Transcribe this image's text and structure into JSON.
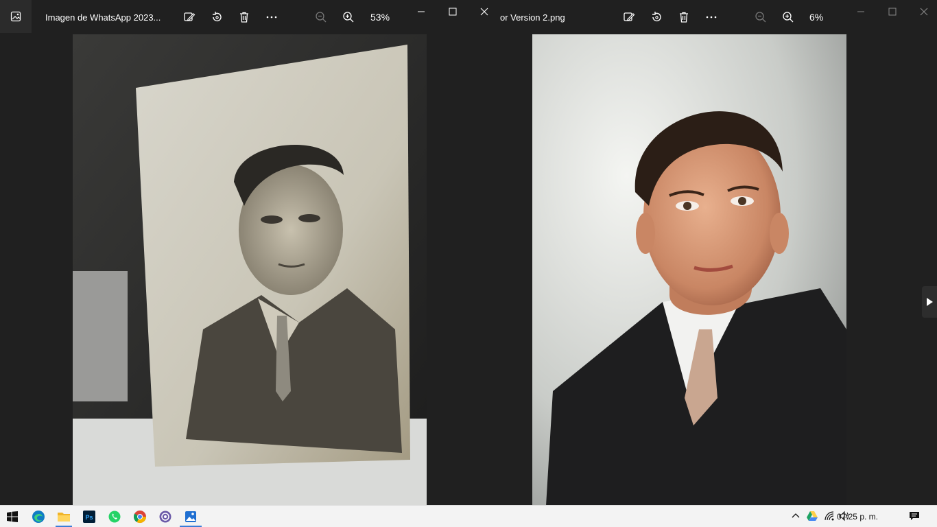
{
  "window1": {
    "title": "Imagen de WhatsApp 2023...",
    "zoom": "53%",
    "icons": [
      "image-app-icon",
      "edit-icon",
      "rotate-icon",
      "delete-icon",
      "more-icon",
      "zoom-out-icon",
      "zoom-in-icon"
    ]
  },
  "window2": {
    "title": "or  Version 2.png",
    "zoom": "6%",
    "icons": [
      "edit-icon",
      "rotate-icon",
      "delete-icon",
      "more-icon",
      "zoom-out-icon",
      "zoom-in-icon",
      "next-image-icon"
    ]
  },
  "photos": {
    "left": {
      "description_visible": false
    },
    "right": {
      "description_visible": false
    }
  },
  "taskbar": {
    "apps": [
      "start-icon",
      "edge-icon",
      "file-explorer-icon",
      "photoshop-icon",
      "whatsapp-icon",
      "chrome-icon",
      "app-icon",
      "photos-icon"
    ],
    "photoshop_label": "Ps",
    "clock": "07:25 p. m.",
    "tray": [
      "chevron-up-icon",
      "google-drive-icon",
      "network-icon",
      "volume-icon",
      "notifications-icon"
    ]
  },
  "colors": {
    "background": "#202020",
    "taskbar": "#f3f3f3",
    "accent": "#3b7dd8"
  }
}
